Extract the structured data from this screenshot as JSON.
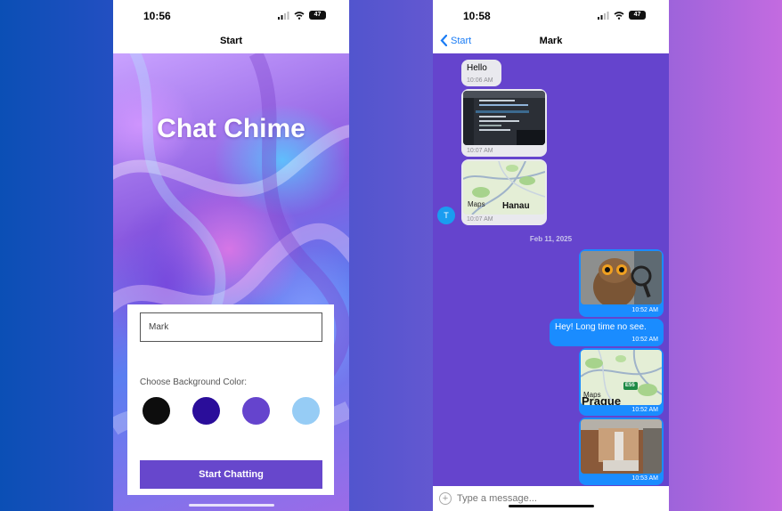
{
  "start_screen": {
    "status_time": "10:56",
    "battery": "47",
    "nav_title": "Start",
    "app_title": "Chat Chime",
    "name_input": {
      "value": "Mark",
      "placeholder": ""
    },
    "color_label": "Choose Background Color:",
    "swatches": [
      {
        "name": "black",
        "color": "#0d0d0d"
      },
      {
        "name": "indigo",
        "color": "#2a0d9a"
      },
      {
        "name": "purple",
        "color": "#6544cd"
      },
      {
        "name": "light-blue",
        "color": "#96ccf5"
      }
    ],
    "start_button": "Start Chatting"
  },
  "chat_screen": {
    "status_time": "10:58",
    "battery": "47",
    "back_label": "Start",
    "nav_title": "Mark",
    "background_color": "#6544cd",
    "avatar_initial": "T",
    "date_separator": "Feb 11, 2025",
    "messages": [
      {
        "side": "in",
        "type": "text",
        "text": "Hello",
        "time": "10:06 AM"
      },
      {
        "side": "in",
        "type": "image",
        "image": "code-screenshot",
        "time": "10:07 AM"
      },
      {
        "side": "in",
        "type": "map",
        "map_brand": "Maps",
        "map_label": "Hanau",
        "time": "10:07 AM"
      },
      {
        "side": "out",
        "type": "image",
        "image": "owl-with-magnifier",
        "time": "10:52 AM"
      },
      {
        "side": "out",
        "type": "text",
        "text": "Hey! Long time no see.",
        "time": "10:52 AM"
      },
      {
        "side": "out",
        "type": "map",
        "map_brand": "Maps",
        "map_label": "Prague",
        "road_sign": "E55",
        "time": "10:52 AM"
      },
      {
        "side": "out",
        "type": "image",
        "image": "cork-board-photo",
        "time": "10:53 AM"
      }
    ],
    "composer_placeholder": "Type a message..."
  }
}
